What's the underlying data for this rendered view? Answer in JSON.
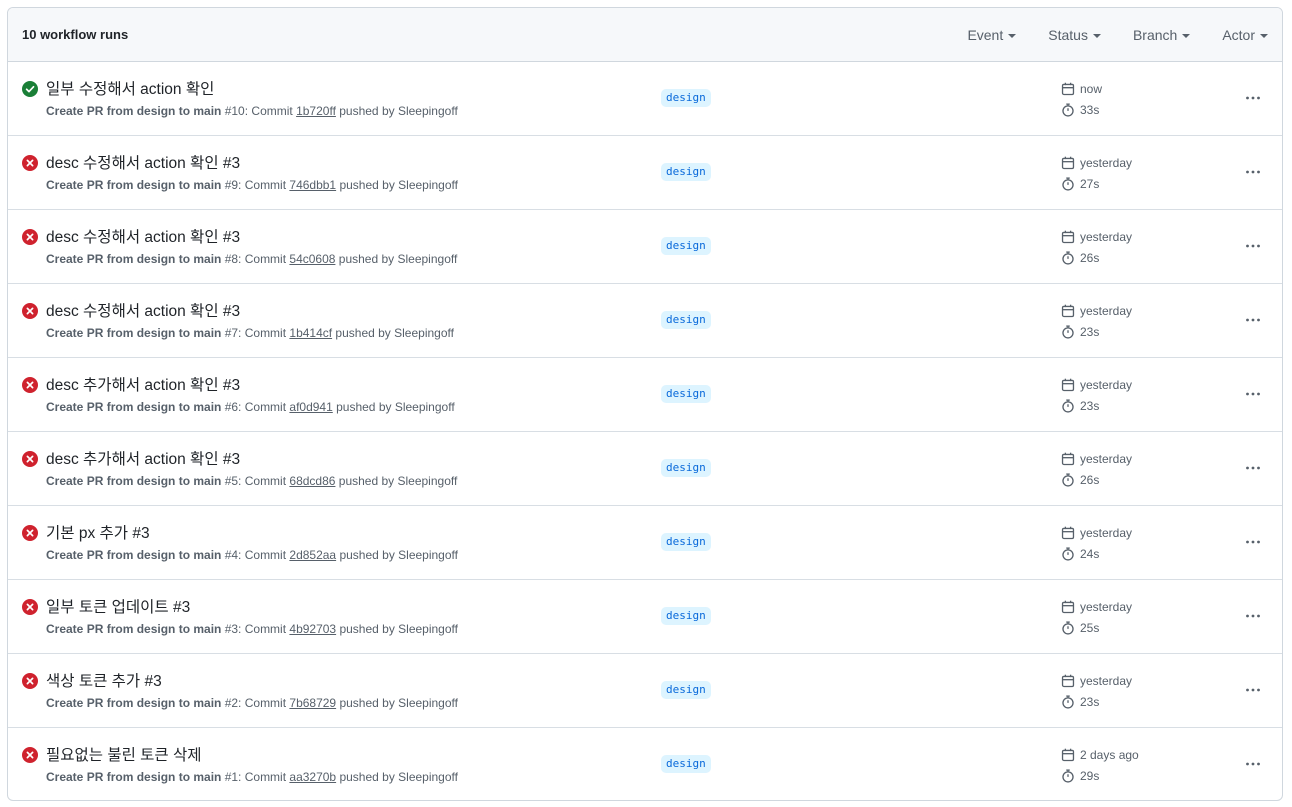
{
  "header": {
    "run_count": "10 workflow runs",
    "filters": [
      {
        "label": "Event"
      },
      {
        "label": "Status"
      },
      {
        "label": "Branch"
      },
      {
        "label": "Actor"
      }
    ]
  },
  "colors": {
    "success": "#1a7f37",
    "failure": "#cf222e",
    "branch_bg": "#ddf4ff",
    "branch_fg": "#0969da"
  },
  "runs": [
    {
      "status": "success",
      "title": "일부 수정해서 action 확인",
      "workflow": "Create PR from design to main",
      "meta": " #10: Commit ",
      "sha": "1b720ff",
      "pushed": " pushed by Sleepingoff",
      "branch": "design",
      "when": "now",
      "duration": "33s"
    },
    {
      "status": "failure",
      "title": "desc 수정해서 action 확인 #3",
      "workflow": "Create PR from design to main",
      "meta": " #9: Commit ",
      "sha": "746dbb1",
      "pushed": " pushed by Sleepingoff",
      "branch": "design",
      "when": "yesterday",
      "duration": "27s"
    },
    {
      "status": "failure",
      "title": "desc 수정해서 action 확인 #3",
      "workflow": "Create PR from design to main",
      "meta": " #8: Commit ",
      "sha": "54c0608",
      "pushed": " pushed by Sleepingoff",
      "branch": "design",
      "when": "yesterday",
      "duration": "26s"
    },
    {
      "status": "failure",
      "title": "desc 수정해서 action 확인 #3",
      "workflow": "Create PR from design to main",
      "meta": " #7: Commit ",
      "sha": "1b414cf",
      "pushed": " pushed by Sleepingoff",
      "branch": "design",
      "when": "yesterday",
      "duration": "23s"
    },
    {
      "status": "failure",
      "title": "desc 추가해서 action 확인 #3",
      "workflow": "Create PR from design to main",
      "meta": " #6: Commit ",
      "sha": "af0d941",
      "pushed": " pushed by Sleepingoff",
      "branch": "design",
      "when": "yesterday",
      "duration": "23s"
    },
    {
      "status": "failure",
      "title": "desc 추가해서 action 확인 #3",
      "workflow": "Create PR from design to main",
      "meta": " #5: Commit ",
      "sha": "68dcd86",
      "pushed": " pushed by Sleepingoff",
      "branch": "design",
      "when": "yesterday",
      "duration": "26s"
    },
    {
      "status": "failure",
      "title": "기본 px 추가 #3",
      "workflow": "Create PR from design to main",
      "meta": " #4: Commit ",
      "sha": "2d852aa",
      "pushed": " pushed by Sleepingoff",
      "branch": "design",
      "when": "yesterday",
      "duration": "24s"
    },
    {
      "status": "failure",
      "title": "일부 토큰 업데이트 #3",
      "workflow": "Create PR from design to main",
      "meta": " #3: Commit ",
      "sha": "4b92703",
      "pushed": " pushed by Sleepingoff",
      "branch": "design",
      "when": "yesterday",
      "duration": "25s"
    },
    {
      "status": "failure",
      "title": "색상 토큰 추가 #3",
      "workflow": "Create PR from design to main",
      "meta": " #2: Commit ",
      "sha": "7b68729",
      "pushed": " pushed by Sleepingoff",
      "branch": "design",
      "when": "yesterday",
      "duration": "23s"
    },
    {
      "status": "failure",
      "title": "필요없는 불린 토큰 삭제",
      "workflow": "Create PR from design to main",
      "meta": " #1: Commit ",
      "sha": "aa3270b",
      "pushed": " pushed by Sleepingoff",
      "branch": "design",
      "when": "2 days ago",
      "duration": "29s"
    }
  ]
}
